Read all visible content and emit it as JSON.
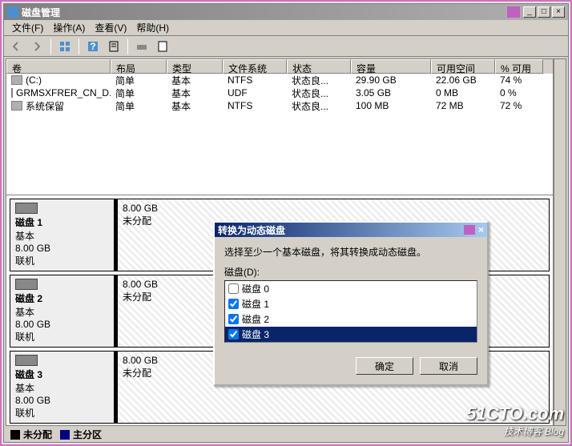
{
  "window": {
    "title": "磁盘管理",
    "buttons": {
      "min": "_",
      "max": "□",
      "close": "×"
    }
  },
  "menu": {
    "file": "文件(F)",
    "action": "操作(A)",
    "view": "查看(V)",
    "help": "帮助(H)"
  },
  "columns": {
    "volume": "卷",
    "layout": "布局",
    "type": "类型",
    "fs": "文件系统",
    "status": "状态",
    "capacity": "容量",
    "free": "可用空间",
    "pct": "% 可用"
  },
  "volumes": [
    {
      "name": "(C:)",
      "layout": "简单",
      "type": "基本",
      "fs": "NTFS",
      "status": "状态良...",
      "capacity": "29.90 GB",
      "free": "22.06 GB",
      "pct": "74 %"
    },
    {
      "name": "GRMSXFRER_CN_D...",
      "layout": "简单",
      "type": "基本",
      "fs": "UDF",
      "status": "状态良...",
      "capacity": "3.05 GB",
      "free": "0 MB",
      "pct": "0 %"
    },
    {
      "name": "系统保留",
      "layout": "简单",
      "type": "基本",
      "fs": "NTFS",
      "status": "状态良...",
      "capacity": "100 MB",
      "free": "72 MB",
      "pct": "72 %"
    }
  ],
  "disks": [
    {
      "name": "磁盘 1",
      "type": "基本",
      "size": "8.00 GB",
      "status": "联机",
      "part_size": "8.00 GB",
      "part_status": "未分配"
    },
    {
      "name": "磁盘 2",
      "type": "基本",
      "size": "8.00 GB",
      "status": "联机",
      "part_size": "8.00 GB",
      "part_status": "未分配"
    },
    {
      "name": "磁盘 3",
      "type": "基本",
      "size": "8.00 GB",
      "status": "联机",
      "part_size": "8.00 GB",
      "part_status": "未分配"
    }
  ],
  "legend": {
    "unalloc": "未分配",
    "primary": "主分区"
  },
  "dialog": {
    "title": "转换为动态磁盘",
    "instruction": "选择至少一个基本磁盘，将其转换成动态磁盘。",
    "list_label": "磁盘(D):",
    "options": [
      {
        "label": "磁盘 0",
        "checked": false,
        "selected": false
      },
      {
        "label": "磁盘 1",
        "checked": true,
        "selected": false
      },
      {
        "label": "磁盘 2",
        "checked": true,
        "selected": false
      },
      {
        "label": "磁盘 3",
        "checked": true,
        "selected": true
      }
    ],
    "ok": "确定",
    "cancel": "取消",
    "close": "×"
  },
  "watermark": {
    "line1": "51CTO.com",
    "line2": "技术博客  Blog"
  }
}
